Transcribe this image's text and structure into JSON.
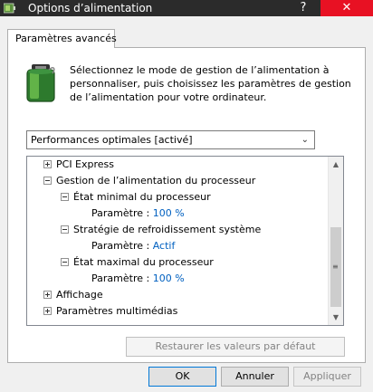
{
  "window": {
    "title": "Options d’alimentation",
    "help_label": "?",
    "close_label": "✕"
  },
  "tab": {
    "label": "Paramètres avancés"
  },
  "intro_text": "Sélectionnez le mode de gestion de l’alimentation à personnaliser, puis choisissez les paramètres de gestion de l’alimentation pour votre ordinateur.",
  "plan_select": {
    "value": "Performances optimales [activé]"
  },
  "tree": {
    "items": [
      {
        "label": "PCI Express"
      },
      {
        "label": "Gestion de l’alimentation du processeur"
      },
      {
        "label": "État minimal du processeur"
      },
      {
        "label": "Paramètre :",
        "value": "100  %"
      },
      {
        "label": "Stratégie de refroidissement système"
      },
      {
        "label": "Paramètre :",
        "value": "Actif"
      },
      {
        "label": "État maximal du processeur"
      },
      {
        "label": "Paramètre :",
        "value": "100  %"
      },
      {
        "label": "Affichage"
      },
      {
        "label": "Paramètres multimédias"
      }
    ]
  },
  "buttons": {
    "restore": "Restaurer les valeurs par défaut",
    "ok": "OK",
    "cancel": "Annuler",
    "apply": "Appliquer"
  },
  "colors": {
    "title_bar": "#2b2b2b",
    "close_hover": "#e81123",
    "value_text": "#0060c0"
  }
}
